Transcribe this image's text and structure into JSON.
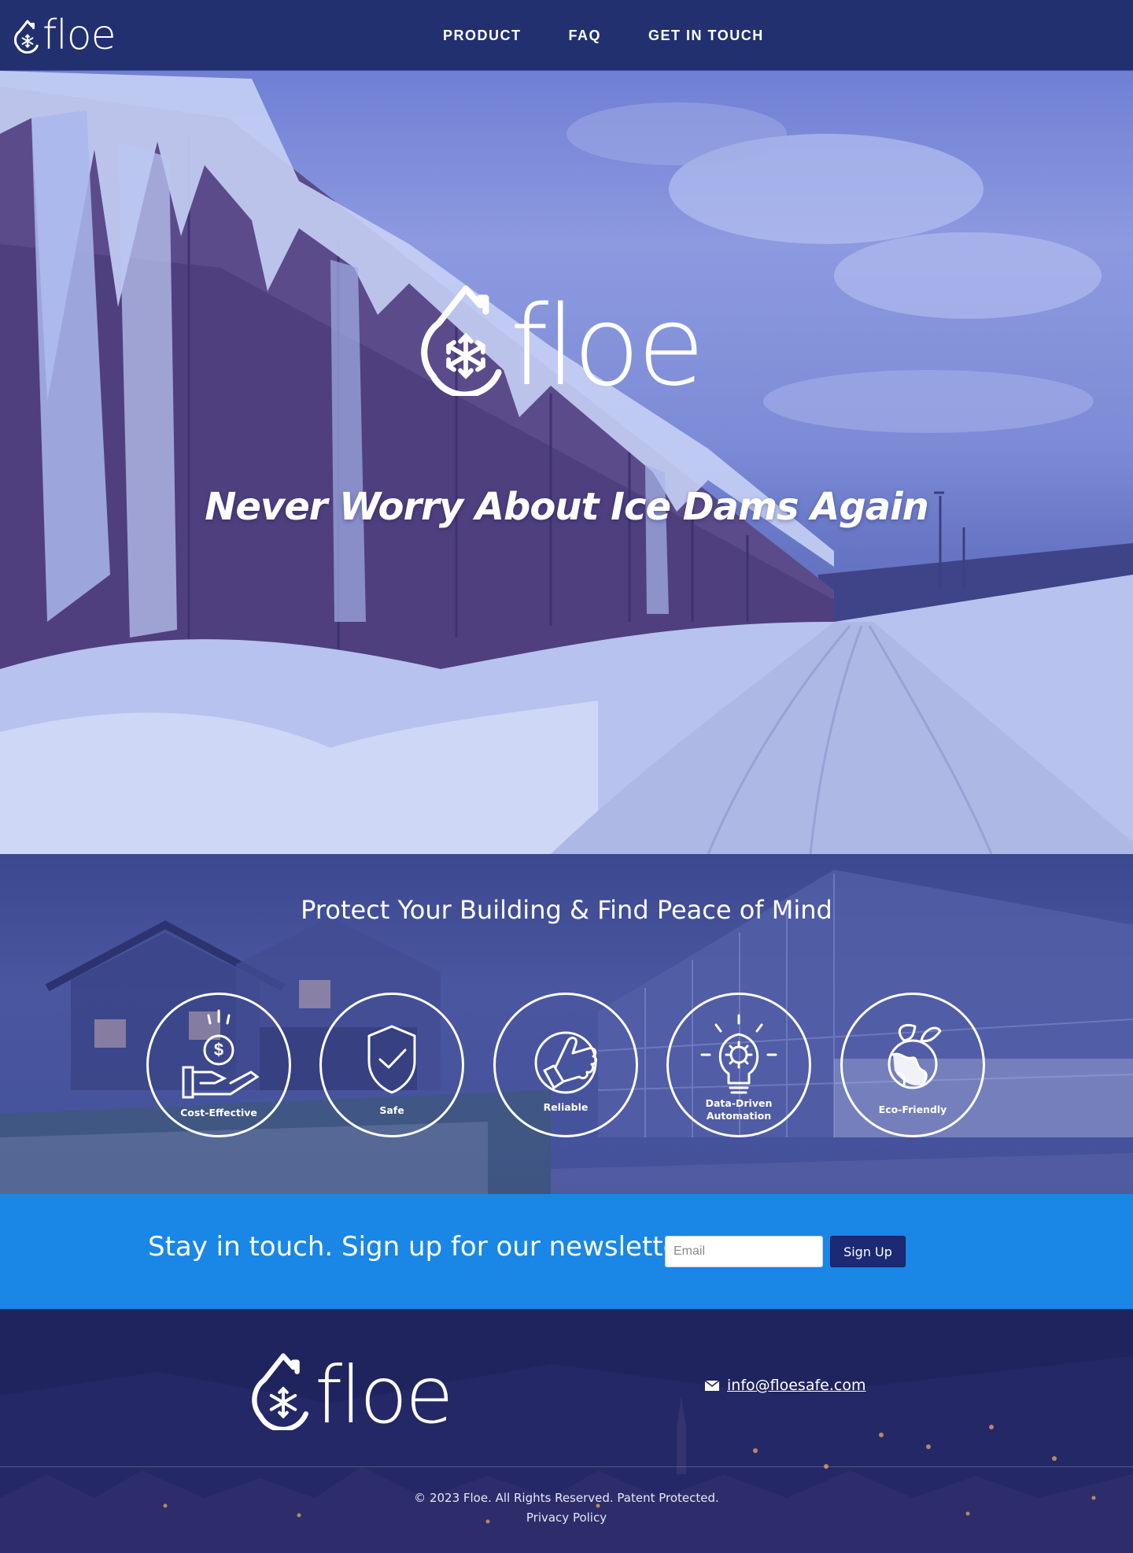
{
  "brand": {
    "name": "floe",
    "logo_icon": "snowflake-drop-icon"
  },
  "nav": {
    "links": [
      "PRODUCT",
      "FAQ",
      "GET IN TOUCH"
    ]
  },
  "hero": {
    "tagline": "Never Worry About Ice Dams Again"
  },
  "features": {
    "title": "Protect Your Building & Find Peace of Mind",
    "items": [
      {
        "label": "Cost-Effective",
        "icon": "money-hand-icon"
      },
      {
        "label": "Safe",
        "icon": "shield-check-icon"
      },
      {
        "label": "Reliable",
        "icon": "thumbs-up-icon"
      },
      {
        "label_line1": "Data-Driven",
        "label_line2": "Automation",
        "icon": "lightbulb-gear-icon"
      },
      {
        "label": "Eco-Friendly",
        "icon": "globe-leaves-icon"
      }
    ]
  },
  "newsletter": {
    "heading": "Stay in touch. Sign up for our newsletter:",
    "email_placeholder": "Email",
    "email_value": "",
    "button_label": "Sign Up"
  },
  "footer": {
    "email": "info@floesafe.com",
    "email_icon": "envelope-icon",
    "copyright": "© 2023 Floe. All Rights Reserved. Patent Protected.",
    "privacy": "Privacy Policy"
  },
  "colors": {
    "nav_bg": "#22306f",
    "newsletter_bg": "#1a87e6",
    "button_bg": "#1b2a72",
    "footer_bg": "#1f2460"
  }
}
